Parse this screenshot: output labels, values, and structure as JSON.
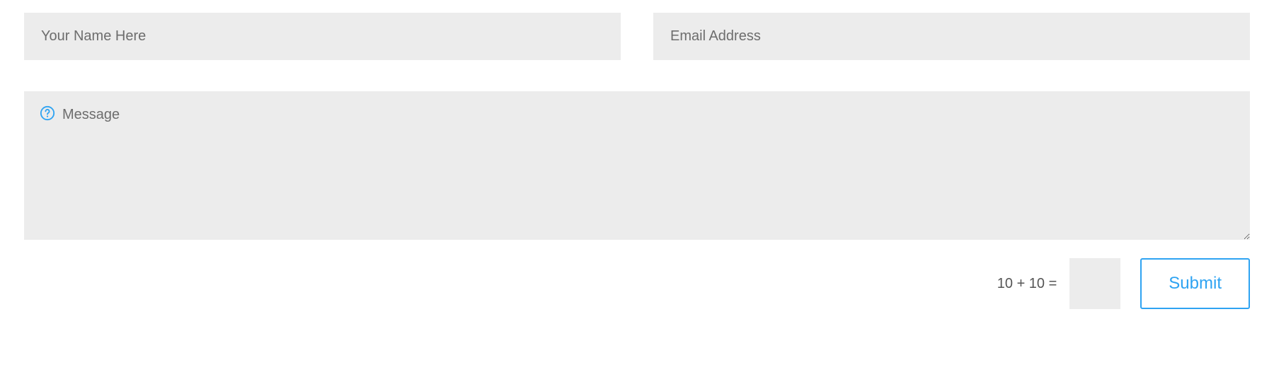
{
  "form": {
    "name_placeholder": "Your Name Here",
    "email_placeholder": "Email Address",
    "message_placeholder": "Message",
    "captcha_question": "10 + 10 =",
    "submit_label": "Submit"
  },
  "colors": {
    "field_bg": "#ececec",
    "accent": "#2ea3f2",
    "placeholder": "#6d6d6d"
  }
}
